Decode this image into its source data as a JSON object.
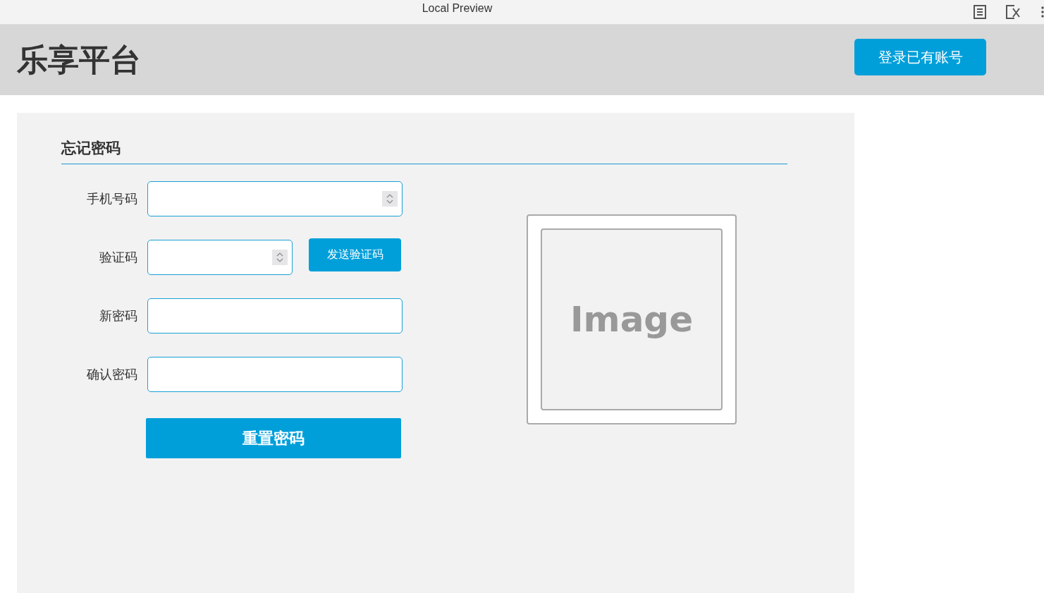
{
  "window": {
    "title": "Local Preview"
  },
  "header": {
    "logo": "乐享平台",
    "login_button": "登录已有账号"
  },
  "form": {
    "title": "忘记密码",
    "fields": [
      {
        "label": "手机号码",
        "kind": "number"
      },
      {
        "label": "验证码",
        "kind": "number",
        "button": "发送验证码"
      },
      {
        "label": "新密码",
        "kind": "text"
      },
      {
        "label": "确认密码",
        "kind": "text"
      }
    ],
    "submit": "重置密码"
  },
  "image_placeholder": {
    "text": "Image"
  }
}
